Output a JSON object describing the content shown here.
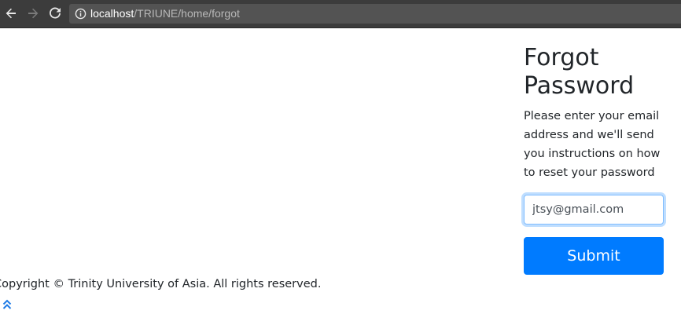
{
  "browser": {
    "url_host": "localhost",
    "url_path": "/TRIUNE/home/forgot",
    "icons": {
      "back": "arrow-left-icon",
      "forward": "arrow-right-icon",
      "reload": "reload-icon",
      "info": "info-circle-icon"
    }
  },
  "forgot": {
    "title": "Forgot Password",
    "description": "Please enter your email address and we'll send you instructions on how to reset your password",
    "email_value": "jtsy@gmail.com",
    "submit_label": "Submit"
  },
  "footer": {
    "copyright": "Copyright © Trinity University of Asia. All rights reserved.",
    "back_to_top_icon": "double-chevron-up-icon"
  },
  "colors": {
    "primary": "#007bff",
    "browser_chrome": "#3c3c3c",
    "omnibox": "#535353",
    "text": "#212529"
  }
}
